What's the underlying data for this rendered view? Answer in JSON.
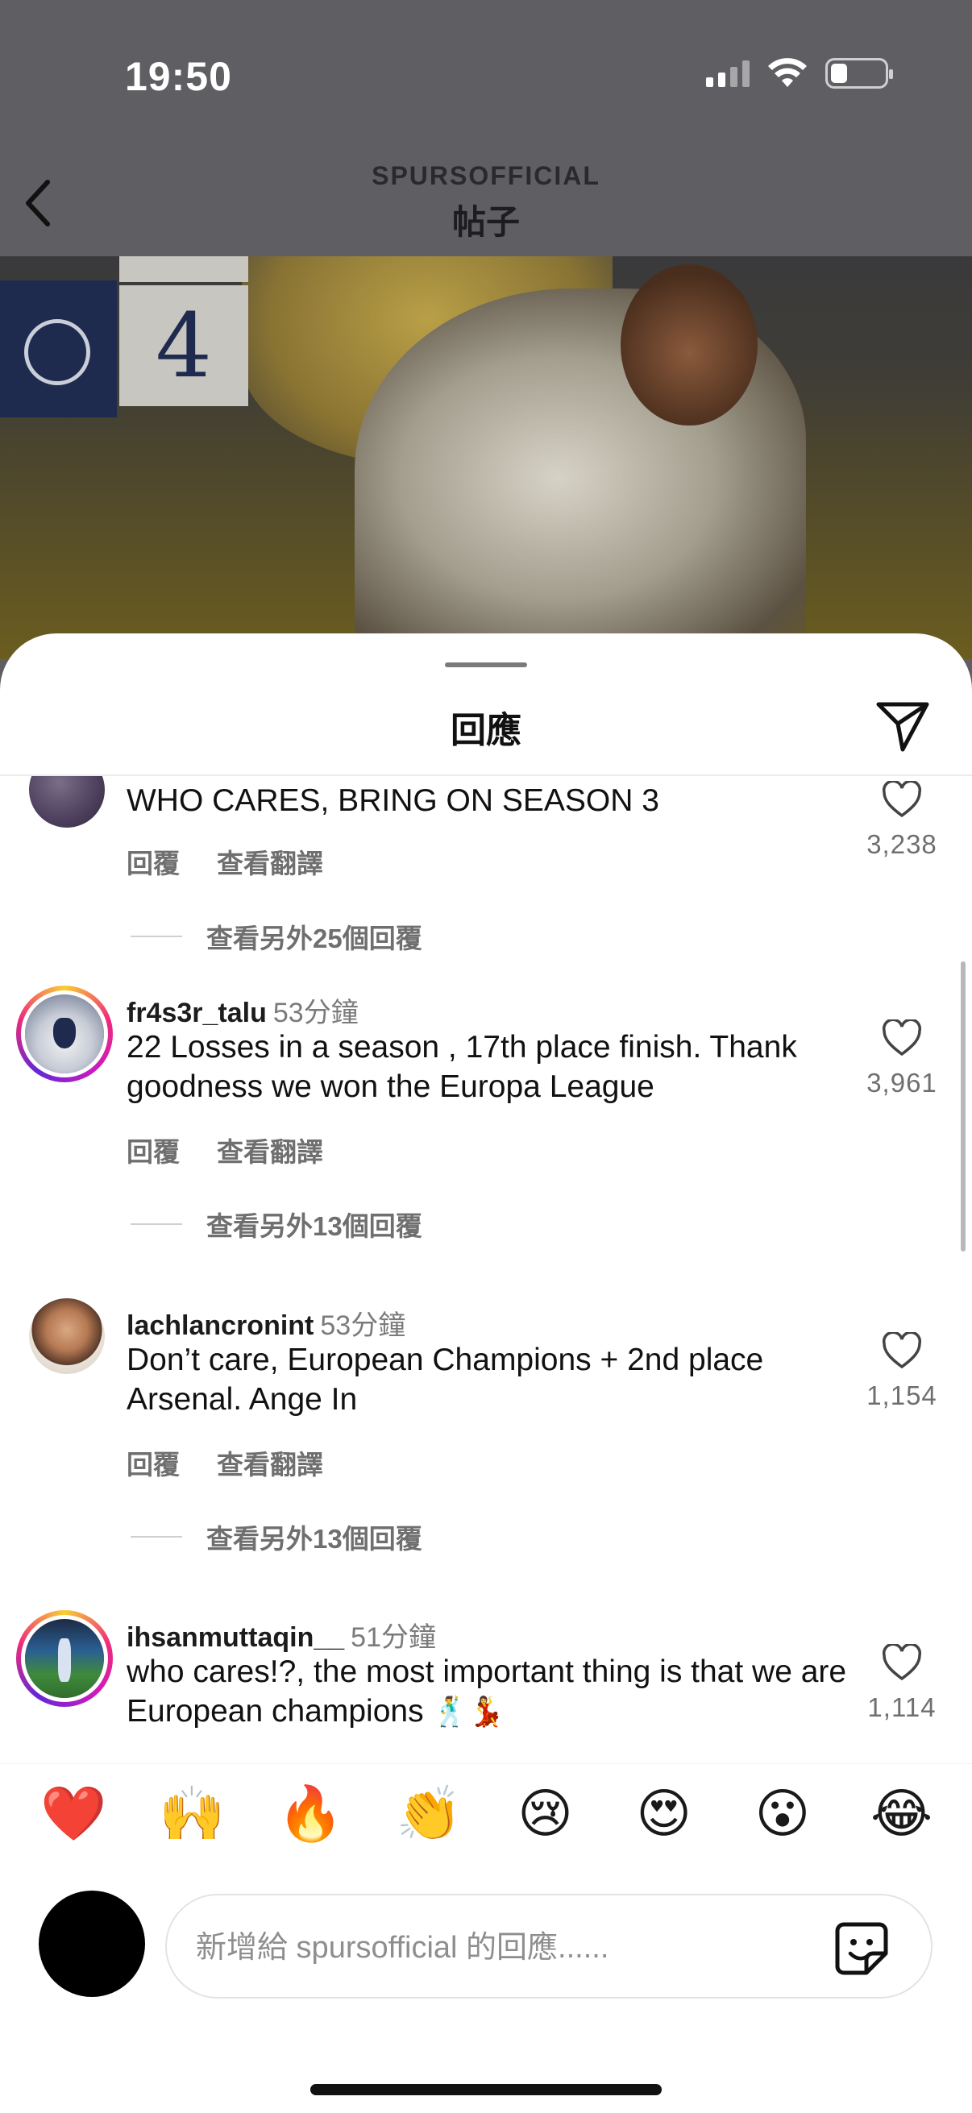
{
  "status_bar": {
    "time": "19:50"
  },
  "header": {
    "subtitle": "SPURSOFFICIAL",
    "title": "帖子"
  },
  "post_image": {
    "score": "4"
  },
  "sheet": {
    "title": "回應"
  },
  "comments": [
    {
      "username": "",
      "time": "",
      "text": "WHO CARES, BRING ON SEASON 3",
      "reply_label": "回覆",
      "translate_label": "查看翻譯",
      "more_replies": "查看另外25個回覆",
      "likes": "3,238"
    },
    {
      "username": "fr4s3r_talu",
      "time": "53分鐘",
      "text": "22 Losses in a season , 17th place finish. Thank goodness we won the Europa League",
      "reply_label": "回覆",
      "translate_label": "查看翻譯",
      "more_replies": "查看另外13個回覆",
      "likes": "3,961"
    },
    {
      "username": "lachlancronint",
      "time": "53分鐘",
      "text": "Don’t care, European Champions + 2nd place Arsenal. Ange In",
      "reply_label": "回覆",
      "translate_label": "查看翻譯",
      "more_replies": "查看另外13個回覆",
      "likes": "1,154"
    },
    {
      "username": "ihsanmuttaqin__",
      "time": "51分鐘",
      "text": "who cares!?, the most important thing is that we are European champions",
      "emojis": "🕺💃",
      "likes": "1,114"
    }
  ],
  "emoji_bar": [
    "❤️",
    "🙌",
    "🔥",
    "👏",
    "😢",
    "😍",
    "😮",
    "😂"
  ],
  "composer": {
    "placeholder": "新增給 spursofficial 的回應......"
  },
  "colors": {
    "like_outline": "#1a1a1a",
    "secondary_text": "#6f6f6f"
  }
}
